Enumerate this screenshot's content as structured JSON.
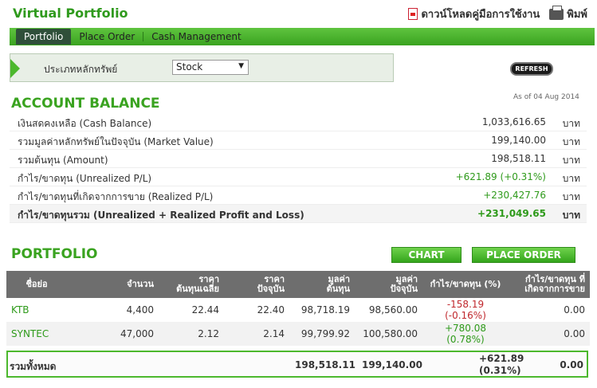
{
  "header": {
    "title": "Virtual Portfolio",
    "download_label": "ดาวน์โหลดคู่มือการใช้งาน",
    "print_label": "พิมพ์"
  },
  "nav": {
    "tabs": [
      "Portfolio",
      "Place Order",
      "Cash Management"
    ],
    "active": "Portfolio"
  },
  "filter": {
    "label": "ประเภทหลักทรัพย์",
    "selected": "Stock"
  },
  "refresh_label": "REFRESH",
  "account": {
    "title": "ACCOUNT BALANCE",
    "as_of": "As of 04 Aug 2014",
    "rows": [
      {
        "label": "เงินสดคงเหลือ (Cash Balance)",
        "value": "1,033,616.65",
        "unit": "บาท"
      },
      {
        "label": "รวมมูลค่าหลักทรัพย์ในปัจจุบัน (Market Value)",
        "value": "199,140.00",
        "unit": "บาท"
      },
      {
        "label": "รวมต้นทุน (Amount)",
        "value": "198,518.11",
        "unit": "บาท"
      },
      {
        "label": "กำไร/ขาดทุน (Unrealized P/L)",
        "value": "+621.89 (+0.31%)",
        "unit": "บาท"
      },
      {
        "label": "กำไร/ขาดทุนที่เกิดจากการขาย (Realized P/L)",
        "value": "+230,427.76",
        "unit": "บาท"
      },
      {
        "label": "กำไร/ขาดทุนรวม (Unrealized + Realized Profit and Loss)",
        "value": "+231,049.65",
        "unit": "บาท"
      }
    ]
  },
  "portfolio": {
    "title": "PORTFOLIO",
    "chart_btn": "CHART",
    "order_btn": "PLACE ORDER",
    "headers": {
      "name": "ชื่อย่อ",
      "qty": "จำนวน",
      "avg_a": "ราคา",
      "avg_b": "ต้นทุนเฉลี่ย",
      "cur_a": "ราคา",
      "cur_b": "ปัจจุบัน",
      "cost_a": "มูลค่า",
      "cost_b": "ต้นทุน",
      "mkt_a": "มูลค่า",
      "mkt_b": "ปัจจุบัน",
      "pl": "กำไร/ขาดทุน (%)",
      "rpl_a": "กำไร/ขาดทุน ที่",
      "rpl_b": "เกิดจากการขาย"
    },
    "rows": [
      {
        "name": "KTB",
        "qty": "4,400",
        "avg": "22.44",
        "cur": "22.40",
        "cost": "98,718.19",
        "mkt": "98,560.00",
        "pl": "-158.19",
        "pl_pct": "(-0.16%)",
        "rpl": "0.00"
      },
      {
        "name": "SYNTEC",
        "qty": "47,000",
        "avg": "2.12",
        "cur": "2.14",
        "cost": "99,799.92",
        "mkt": "100,580.00",
        "pl": "+780.08",
        "pl_pct": "(0.78%)",
        "rpl": "0.00"
      }
    ],
    "total": {
      "label": "รวมทั้งหมด",
      "cost": "198,518.11",
      "mkt": "199,140.00",
      "pl": "+621.89",
      "pl_pct": "(0.31%)",
      "rpl": "0.00"
    }
  }
}
